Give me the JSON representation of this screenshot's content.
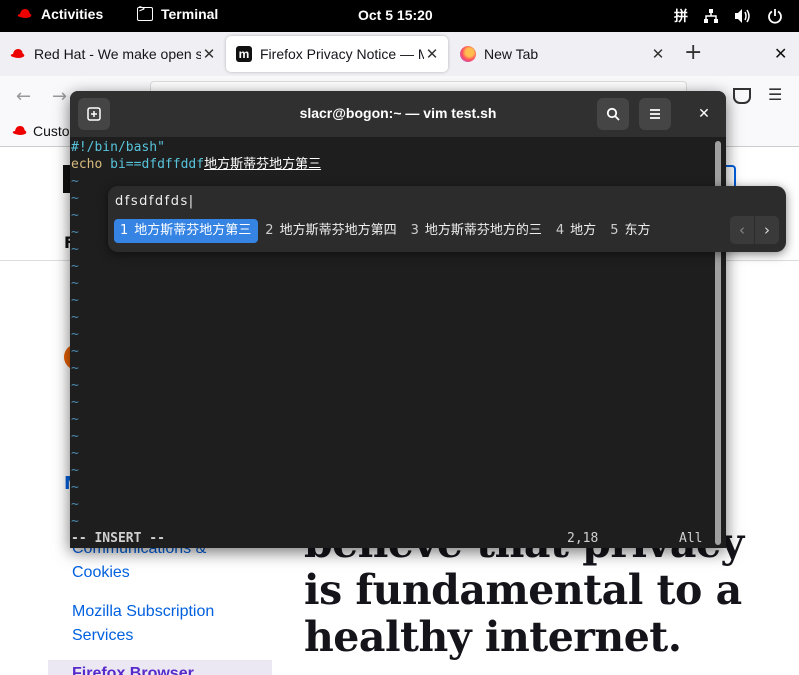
{
  "topbar": {
    "activities": "Activities",
    "app": "Terminal",
    "clock": "Oct 5  15:20",
    "input_method": "拼"
  },
  "browser": {
    "tabs": [
      {
        "label": "Red Hat - We make open source technologies for the enterprise",
        "icon": "redhat-icon",
        "active": false
      },
      {
        "label": "Firefox Privacy Notice — Mozilla",
        "icon": "mozilla-icon",
        "active": true
      },
      {
        "label": "New Tab",
        "icon": "firefox-icon",
        "active": false
      }
    ],
    "bookmark": "Customer Portal",
    "page": {
      "sidebar_links": [
        "Communications & Cookies",
        "Mozilla Subscription Services"
      ],
      "sidebar_active": "Firefox Browser",
      "hero_text": "believe that privacy is fundamental to a healthy internet."
    }
  },
  "terminal": {
    "title": "slacr@bogon:~ — vim test.sh",
    "line1": "#!/bin/bash\"",
    "line2_kw": "echo",
    "line2_ident": " bi==dfdffddf",
    "line2_comp": "地方斯蒂芬地方第三",
    "tilde": "~",
    "mode": "-- INSERT --",
    "position": "2,18",
    "scroll": "All"
  },
  "ime": {
    "preedit": "dfsdfdfds|",
    "candidates": [
      {
        "num": "1",
        "text": "地方斯蒂芬地方第三"
      },
      {
        "num": "2",
        "text": "地方斯蒂芬地方第四"
      },
      {
        "num": "3",
        "text": "地方斯蒂芬地方的三"
      },
      {
        "num": "4",
        "text": "地方"
      },
      {
        "num": "5",
        "text": "东方"
      }
    ],
    "accent_color": "#3584e4"
  }
}
